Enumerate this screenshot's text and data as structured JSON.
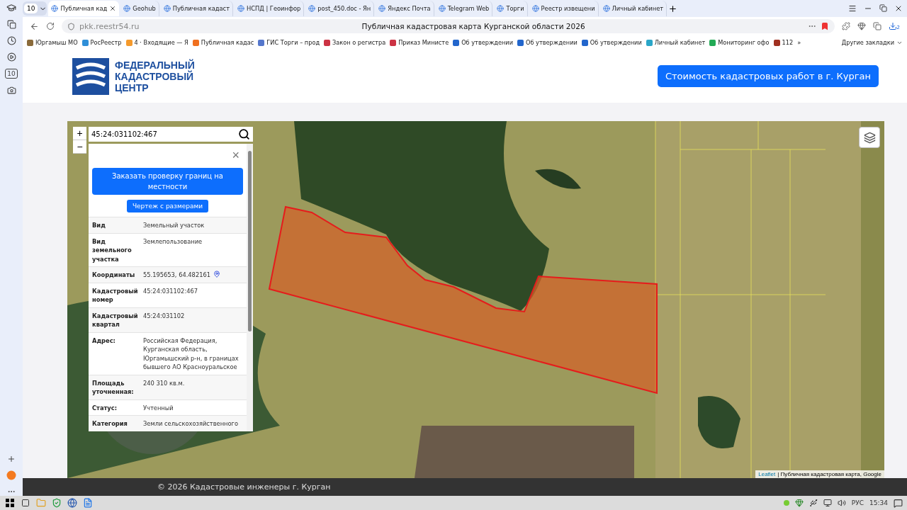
{
  "browser": {
    "tab_count": "10",
    "tabs": [
      {
        "label": "Публичная кад",
        "selected": true
      },
      {
        "label": "Geohub",
        "selected": false
      },
      {
        "label": "Публичная кадаст",
        "selected": false
      },
      {
        "label": "НСПД | Геоинфор",
        "selected": false
      },
      {
        "label": "post_450.doc - Ян",
        "selected": false
      },
      {
        "label": "Яндекс Почта",
        "selected": false
      },
      {
        "label": "Telegram Web",
        "selected": false
      },
      {
        "label": "Торги",
        "selected": false
      },
      {
        "label": "Реестр извещени",
        "selected": false
      },
      {
        "label": "Личный кабинет",
        "selected": false
      }
    ],
    "url": "pkk.reestr54.ru",
    "page_title": "Публичная кадастровая карта Курганской области 2026",
    "downloads_badge": "2",
    "bookmarks": [
      "Юргамыш МО",
      "РосРеестр",
      "4 · Входящие — Я",
      "Публичная кадас",
      "ГИС Торги – прод",
      "Закон о регистра",
      "Приказ Министе",
      "Об утверждении",
      "Об утверждении",
      "Об утверждении",
      "Личный кабинет",
      "Мониторинг офо",
      "112"
    ],
    "bookmarks_more": "»",
    "other_bookmarks": "Другие закладки",
    "sidebar_badge": "10"
  },
  "header": {
    "logo_lines": [
      "ФЕДЕРАЛЬНЫЙ",
      "КАДАСТРОВЫЙ",
      "ЦЕНТР"
    ],
    "cta_button": "Стоимость кадастровых работ в г. Курган"
  },
  "map": {
    "zoom_in": "+",
    "zoom_out": "−",
    "search_value": "45:24:031102:467",
    "panel": {
      "close": "×",
      "order_button": "Заказать проверку границ на местности",
      "drawing_button": "Чертеж с размерами",
      "rows": [
        {
          "label": "Вид",
          "value": "Земельный участок"
        },
        {
          "label": "Вид земельного участка",
          "value": "Землепользование"
        },
        {
          "label": "Координаты",
          "value": "55.195653, 64.482161",
          "kind": "coords"
        },
        {
          "label": "Кадастровый номер",
          "value": "45:24:031102:467"
        },
        {
          "label": "Кадастровый квартал",
          "value": "45:24:031102"
        },
        {
          "label": "Адрес:",
          "value": "Российская Федерация, Курганская область, Юргамышский р-н, в границах бывшего АО Красноуральское"
        },
        {
          "label": "Площадь уточненная:",
          "value": "240 310 кв.м."
        },
        {
          "label": "Статус:",
          "value": "Учтенный"
        },
        {
          "label": "Категория",
          "value": "Земли сельскохозяйственного"
        }
      ]
    },
    "attribution_link": "Leaflet",
    "attribution_text": "| Публичная кадастровая карта, Google"
  },
  "footer": "© 2026 Кадастровые инженеры г. Курган",
  "taskbar": {
    "language": "РУС",
    "time": "15:34"
  }
}
